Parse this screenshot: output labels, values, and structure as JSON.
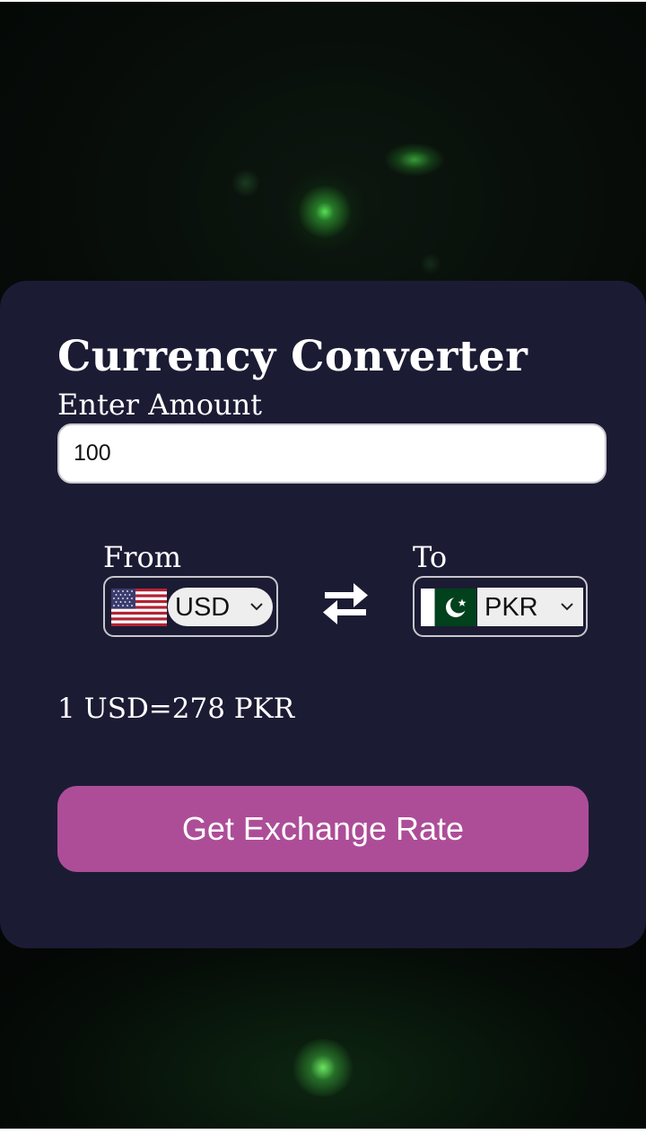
{
  "converter": {
    "title": "Currency Converter",
    "amount_label": "Enter Amount",
    "amount_value": "100",
    "from_label": "From",
    "to_label": "To",
    "from_currency": "USD",
    "to_currency": "PKR",
    "rate_text": "1 USD=278 PKR",
    "button_label": "Get Exchange Rate",
    "icons": {
      "from_flag": "us-flag-icon",
      "to_flag": "pk-flag-icon",
      "swap": "swap-arrows-icon",
      "dropdown": "chevron-down-icon"
    }
  },
  "colors": {
    "card_background": "#1c1b34",
    "button_background": "#ad4d98",
    "page_background": "#050806",
    "glow_green": "#5aeb5a"
  }
}
